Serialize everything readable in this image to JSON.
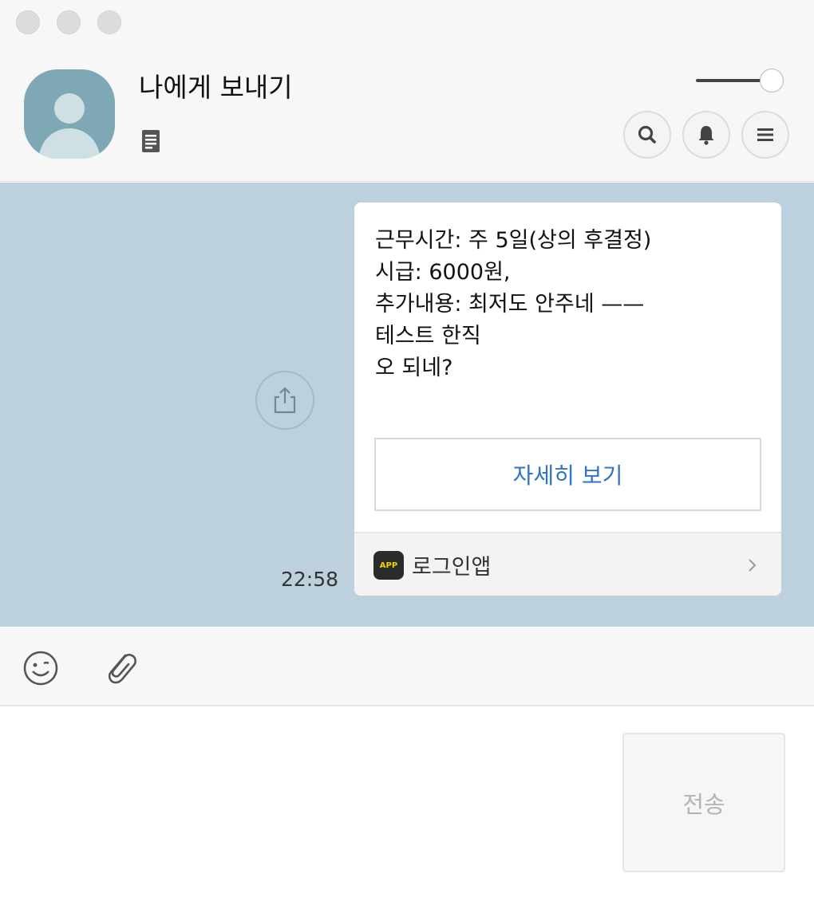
{
  "window": {
    "chat_title": "나에게 보내기"
  },
  "header": {
    "icons": [
      "notes-icon",
      "search-icon",
      "bell-icon",
      "menu-icon"
    ]
  },
  "message": {
    "lines": [
      "근무시간: 주 5일(상의 후결정)",
      "시급: 6000원,",
      "추가내용: 최저도 안주네 ——",
      "테스트 한직",
      "오 되네?"
    ],
    "detail_button": "자세히 보기",
    "app_badge": "APP",
    "app_name": "로그인앱",
    "time": "22:58"
  },
  "composer": {
    "send_label": "전송"
  },
  "colors": {
    "chat_background": "#bcd1dd",
    "link_blue": "#2f72c6",
    "avatar": "#7ea8b6"
  }
}
